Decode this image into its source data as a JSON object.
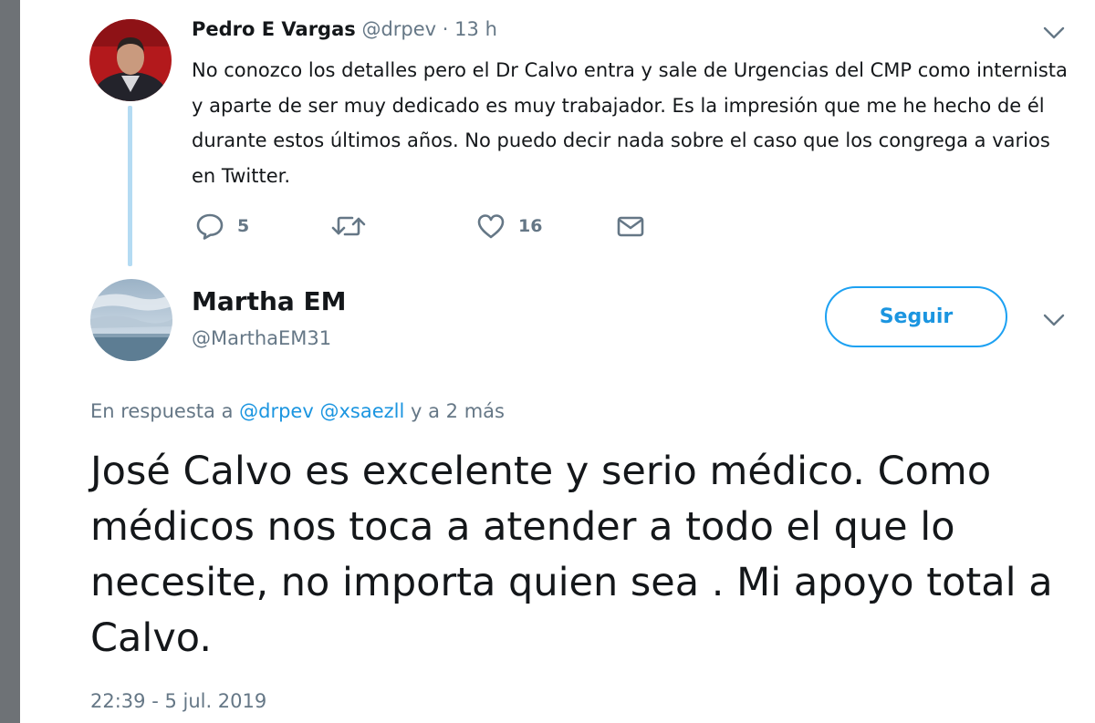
{
  "parent_tweet": {
    "author_name": "Pedro E Vargas",
    "author_handle": "@drpev",
    "separator": "·",
    "time_ago": "13 h",
    "text": "No conozco los detalles pero el Dr Calvo entra y sale de Urgencias del CMP como internista y aparte de ser muy dedicado es muy trabajador. Es la impresión que me he hecho de él durante estos últimos años. No puedo decir nada sobre el caso que los congrega a varios en Twitter.",
    "actions": {
      "reply_icon": "reply-bubble-icon",
      "reply_count": "5",
      "retweet_icon": "retweet-icon",
      "like_icon": "heart-icon",
      "like_count": "16",
      "dm_icon": "envelope-icon"
    }
  },
  "main_tweet": {
    "author_name": "Martha EM",
    "author_handle": "@MarthaEM31",
    "follow_label": "Seguir",
    "reply_prefix": "En respuesta a",
    "reply_mentions": [
      "@drpev",
      "@xsaezll"
    ],
    "reply_suffix": "y a 2 más",
    "text": "José Calvo es excelente y serio médico. Como médicos nos toca a atender a todo el que lo necesite, no importa quien sea . Mi apoyo total a Calvo.",
    "timestamp": "22:39 - 5 jul. 2019"
  },
  "colors": {
    "accent": "#1da1f2",
    "link": "#1b95e0",
    "secondary_text": "#657786",
    "thread_line": "#b4dbf3",
    "left_gutter": "#6e7276"
  }
}
